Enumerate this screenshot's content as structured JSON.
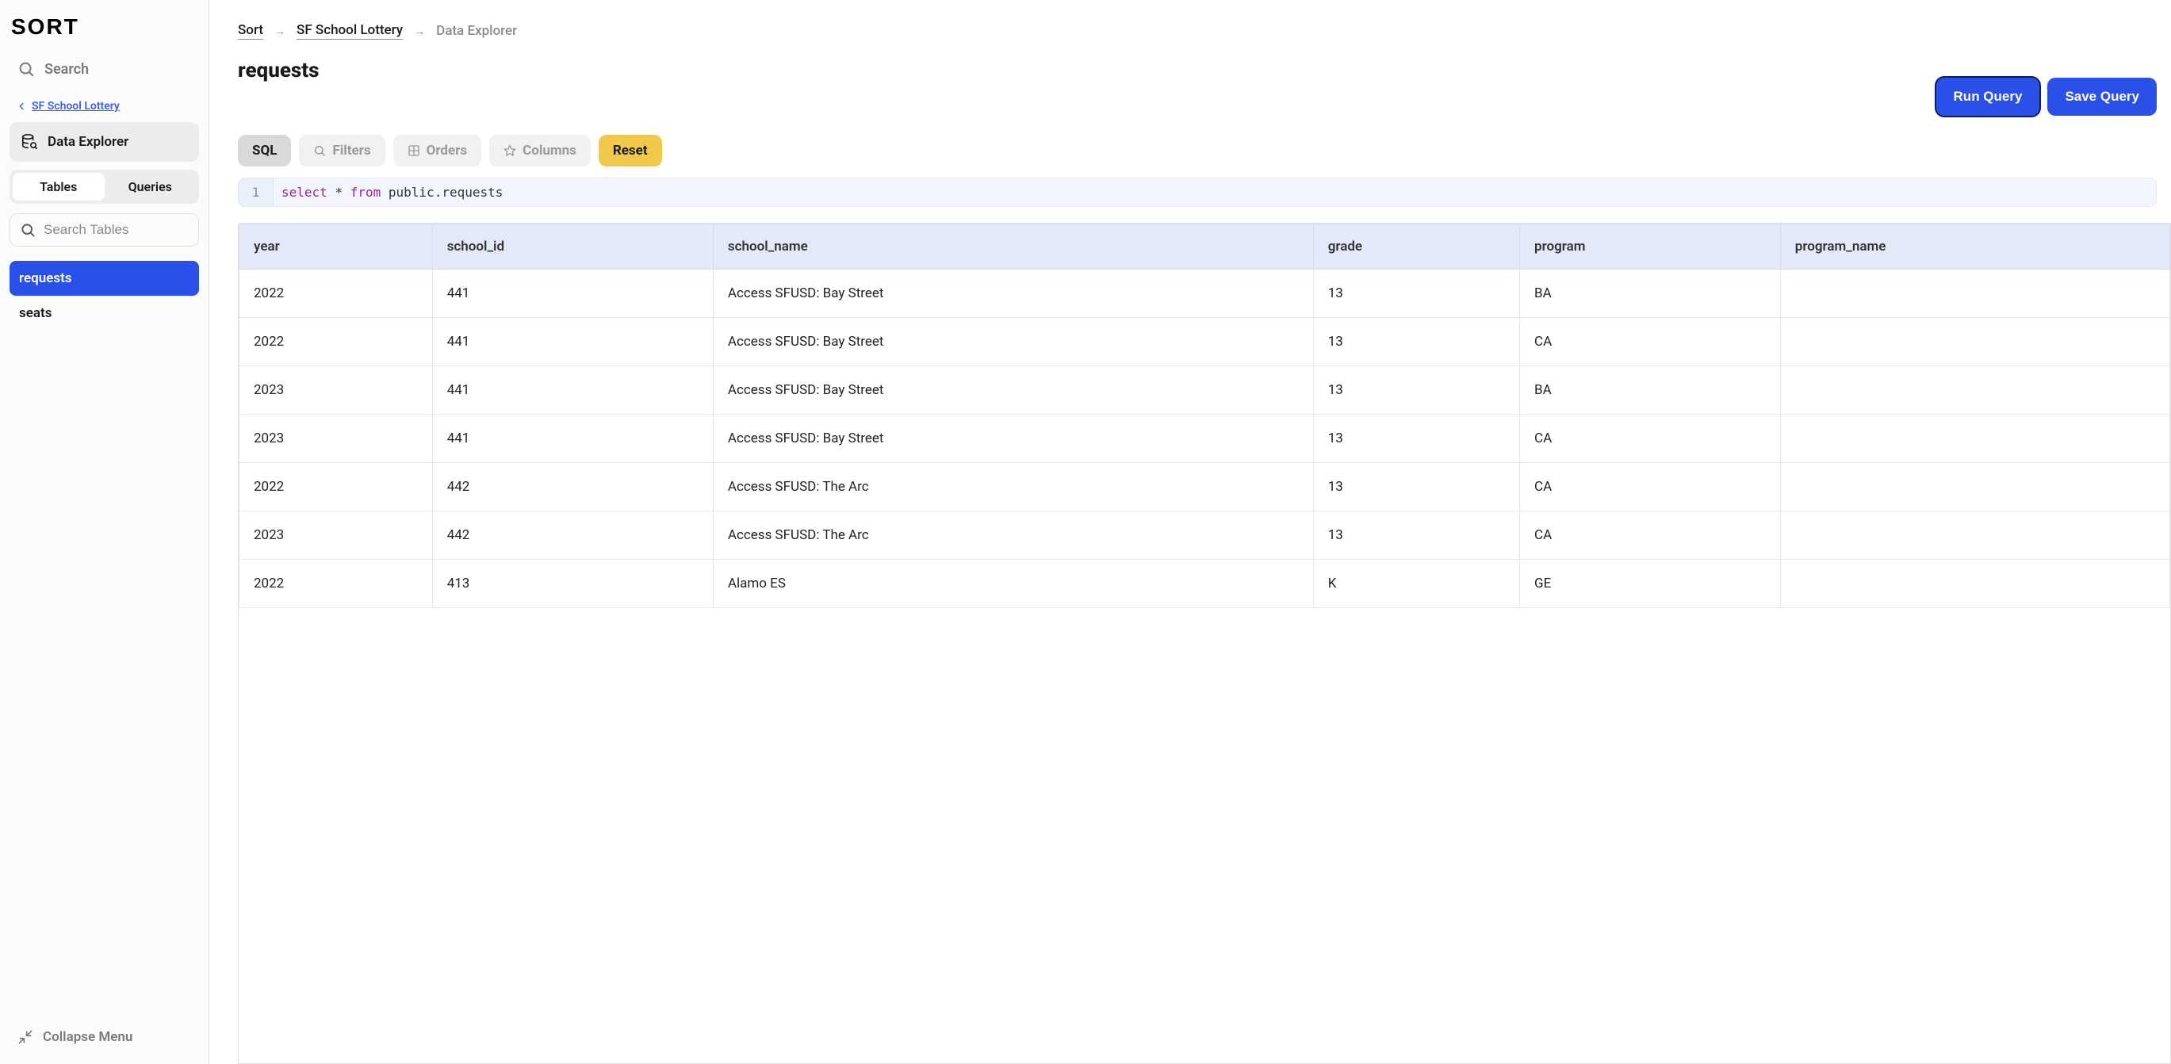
{
  "logo_text": "SORT",
  "sidebar": {
    "search_label": "Search",
    "back_label": "SF School Lottery",
    "nav_label": "Data Explorer",
    "tabs": {
      "tables": "Tables",
      "queries": "Queries"
    },
    "search_tables_placeholder": "Search Tables",
    "tables": [
      {
        "name": "requests",
        "active": true
      },
      {
        "name": "seats",
        "active": false
      }
    ],
    "collapse_label": "Collapse Menu"
  },
  "breadcrumb": [
    {
      "label": "Sort",
      "current": false
    },
    {
      "label": "SF School Lottery",
      "current": false
    },
    {
      "label": "Data Explorer",
      "current": true
    }
  ],
  "page_title": "requests",
  "buttons": {
    "run": "Run Query",
    "save": "Save Query"
  },
  "pills": {
    "sql": "SQL",
    "filters": "Filters",
    "orders": "Orders",
    "columns": "Columns",
    "reset": "Reset"
  },
  "query": {
    "line_no": "1",
    "tokens": {
      "select": "select",
      "star": "*",
      "from": "from",
      "table": "public.requests"
    }
  },
  "columns": [
    "year",
    "school_id",
    "school_name",
    "grade",
    "program",
    "program_name"
  ],
  "rows": [
    {
      "year": "2022",
      "school_id": "441",
      "school_name": "Access SFUSD: Bay Street",
      "grade": "13",
      "program": "BA",
      "program_name": ""
    },
    {
      "year": "2022",
      "school_id": "441",
      "school_name": "Access SFUSD: Bay Street",
      "grade": "13",
      "program": "CA",
      "program_name": ""
    },
    {
      "year": "2023",
      "school_id": "441",
      "school_name": "Access SFUSD: Bay Street",
      "grade": "13",
      "program": "BA",
      "program_name": ""
    },
    {
      "year": "2023",
      "school_id": "441",
      "school_name": "Access SFUSD: Bay Street",
      "grade": "13",
      "program": "CA",
      "program_name": ""
    },
    {
      "year": "2022",
      "school_id": "442",
      "school_name": "Access SFUSD: The Arc",
      "grade": "13",
      "program": "CA",
      "program_name": ""
    },
    {
      "year": "2023",
      "school_id": "442",
      "school_name": "Access SFUSD: The Arc",
      "grade": "13",
      "program": "CA",
      "program_name": ""
    },
    {
      "year": "2022",
      "school_id": "413",
      "school_name": "Alamo ES",
      "grade": "K",
      "program": "GE",
      "program_name": ""
    }
  ]
}
